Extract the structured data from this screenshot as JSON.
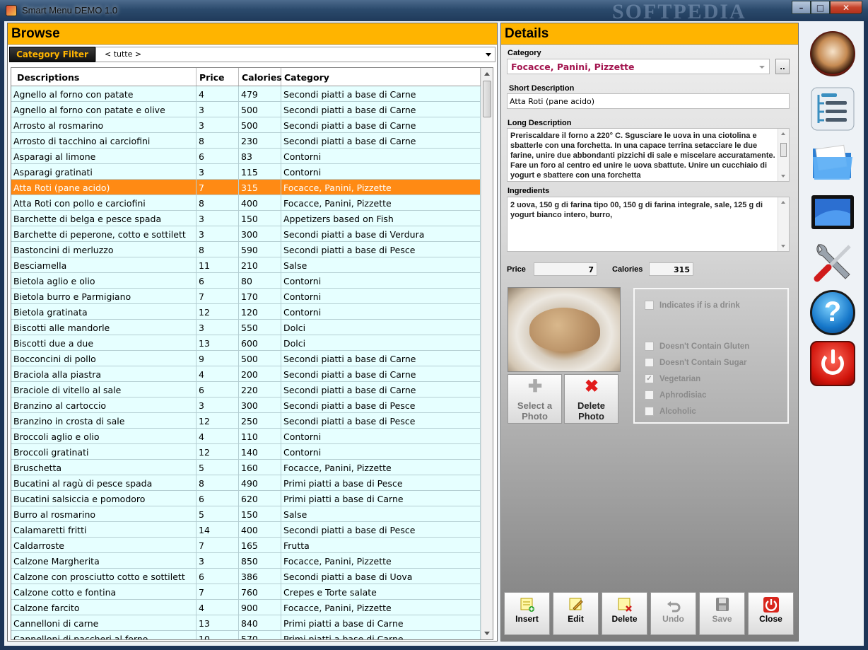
{
  "window": {
    "title": "Smart Menu DEMO 1.0",
    "watermark": "SOFTPEDIA",
    "min_label": "–",
    "max_label": "□",
    "close_label": "✕"
  },
  "browse": {
    "header": "Browse",
    "filter_label": "Category Filter",
    "filter_value": "< tutte >",
    "columns": [
      "Descriptions",
      "Price",
      "Calories",
      "Category"
    ],
    "rows": [
      [
        "Agnello al forno con patate",
        "4",
        "479",
        "Secondi piatti a base di Carne"
      ],
      [
        "Agnello al forno con patate e olive",
        "3",
        "500",
        "Secondi piatti a base di Carne"
      ],
      [
        "Arrosto al rosmarino",
        "3",
        "500",
        "Secondi piatti a base di Carne"
      ],
      [
        "Arrosto di tacchino ai carciofini",
        "8",
        "230",
        "Secondi piatti a base di Carne"
      ],
      [
        "Asparagi al limone",
        "6",
        "83",
        "Contorni"
      ],
      [
        "Asparagi gratinati",
        "3",
        "115",
        "Contorni"
      ],
      [
        "Atta Roti (pane acido)",
        "7",
        "315",
        "Focacce, Panini, Pizzette"
      ],
      [
        "Atta Roti con pollo e carciofini",
        "8",
        "400",
        "Focacce, Panini, Pizzette"
      ],
      [
        "Barchette di belga e pesce spada",
        "3",
        "150",
        "Appetizers based on Fish"
      ],
      [
        "Barchette di peperone, cotto e sottilett",
        "3",
        "300",
        "Secondi piatti a base di Verdura"
      ],
      [
        "Bastoncini di merluzzo",
        "8",
        "590",
        "Secondi piatti a base di Pesce"
      ],
      [
        "Besciamella",
        "11",
        "210",
        "Salse"
      ],
      [
        "Bietola aglio e olio",
        "6",
        "80",
        "Contorni"
      ],
      [
        "Bietola burro e Parmigiano",
        "7",
        "170",
        "Contorni"
      ],
      [
        "Bietola gratinata",
        "12",
        "120",
        "Contorni"
      ],
      [
        "Biscotti alle mandorle",
        "3",
        "550",
        "Dolci"
      ],
      [
        "Biscotti due a due",
        "13",
        "600",
        "Dolci"
      ],
      [
        "Bocconcini di pollo",
        "9",
        "500",
        "Secondi piatti a base di Carne"
      ],
      [
        "Braciola alla piastra",
        "4",
        "200",
        "Secondi piatti a base di Carne"
      ],
      [
        "Braciole di vitello al sale",
        "6",
        "220",
        "Secondi piatti a base di Carne"
      ],
      [
        "Branzino al cartoccio",
        "3",
        "300",
        "Secondi piatti a base di Pesce"
      ],
      [
        "Branzino in crosta di sale",
        "12",
        "250",
        "Secondi piatti a base di Pesce"
      ],
      [
        "Broccoli aglio e olio",
        "4",
        "110",
        "Contorni"
      ],
      [
        "Broccoli gratinati",
        "12",
        "140",
        "Contorni"
      ],
      [
        "Bruschetta",
        "5",
        "160",
        "Focacce, Panini, Pizzette"
      ],
      [
        "Bucatini al ragù di pesce spada",
        "8",
        "490",
        "Primi piatti a base di Pesce"
      ],
      [
        "Bucatini salsiccia e pomodoro",
        "6",
        "620",
        "Primi piatti a base di Carne"
      ],
      [
        "Burro al rosmarino",
        "5",
        "150",
        "Salse"
      ],
      [
        "Calamaretti fritti",
        "14",
        "400",
        "Secondi piatti a base di Pesce"
      ],
      [
        "Caldarroste",
        "7",
        "165",
        "Frutta"
      ],
      [
        "Calzone Margherita",
        "3",
        "850",
        "Focacce, Panini, Pizzette"
      ],
      [
        "Calzone con prosciutto cotto e sottilett",
        "6",
        "386",
        "Secondi piatti a base di Uova"
      ],
      [
        "Calzone cotto e fontina",
        "7",
        "760",
        "Crepes e Torte salate"
      ],
      [
        "Calzone farcito",
        "4",
        "900",
        "Focacce, Panini, Pizzette"
      ],
      [
        "Cannelloni di carne",
        "13",
        "840",
        "Primi piatti a base di Carne"
      ],
      [
        "Cannelloni di paccheri al forno",
        "10",
        "570",
        "Primi piatti a base di Carne"
      ]
    ],
    "selected_row": 6
  },
  "details": {
    "header": "Details",
    "category_label": "Category",
    "category_value": "Focacce, Panini, Pizzette",
    "dots_label": "..",
    "short_label": "Short Description",
    "short_value": "Atta Roti (pane acido)",
    "long_label": "Long Description",
    "long_value": "Preriscaldare il forno a 220° C.  Sgusciare le uova in una ciotolina e sbatterle con una forchetta.  In una capace terrina setacciare le due farine, unire due abbondanti pizzichi di sale e miscelare accuratamente. Fare un foro al centro ed unire le uova sbattute. Unire un cucchiaio di yogurt e sbattere con una forchetta",
    "ingredients_label": "Ingredients",
    "ingredients_value": "2 uova, 150 g di farina tipo 00, 150 g di farina integrale, sale, 125 g di yogurt bianco intero, burro,",
    "price_label": "Price",
    "price_value": "7",
    "calories_label": "Calories",
    "calories_value": "315",
    "select_photo_label": "Select a Photo",
    "delete_photo_label": "Delete Photo",
    "checks": [
      {
        "label": "Indicates if is a drink",
        "checked": false
      },
      {
        "label": "Doesn't Contain Gluten",
        "checked": false
      },
      {
        "label": "Doesn't Contain Sugar",
        "checked": false
      },
      {
        "label": "Vegetarian",
        "checked": true
      },
      {
        "label": "Aphrodisiac",
        "checked": false
      },
      {
        "label": "Alcoholic",
        "checked": false
      }
    ],
    "actions": {
      "insert": "Insert",
      "edit": "Edit",
      "delete": "Delete",
      "undo": "Undo",
      "save": "Save",
      "close": "Close"
    }
  },
  "toolbar": {
    "help_glyph": "?"
  },
  "colors": {
    "header": "#ffb400",
    "row_bg": "#e6ffff",
    "selected_row": "#ff8a14",
    "category_text": "#a3154f"
  },
  "icons": [
    "home-icon",
    "list-icon",
    "folder-icon",
    "monitor-icon",
    "tools-icon",
    "help-icon",
    "power-icon",
    "plus-icon",
    "delete-x-icon",
    "insert-icon",
    "edit-icon",
    "delete-icon",
    "undo-icon",
    "save-icon",
    "close-icon"
  ]
}
